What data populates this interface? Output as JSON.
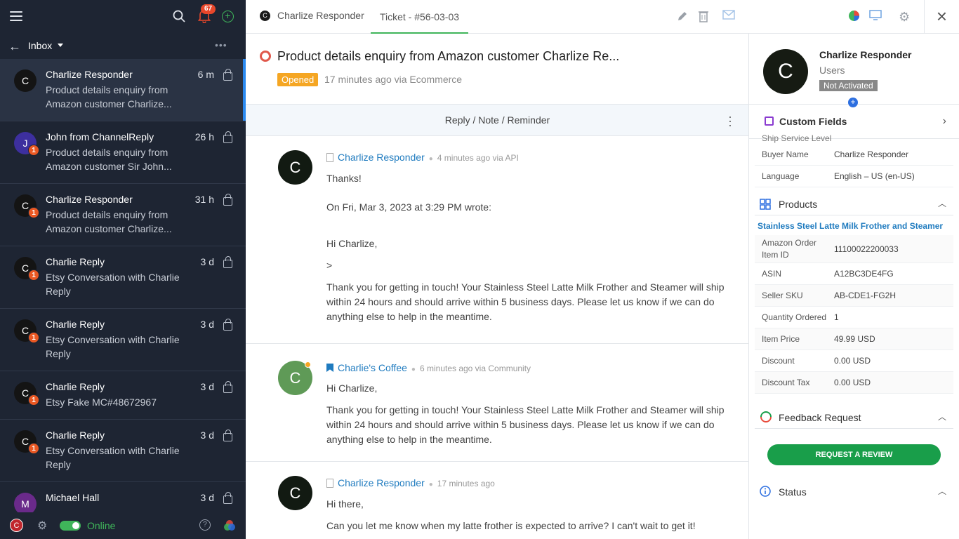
{
  "sidebar": {
    "notification_count": "67",
    "inbox_label": "Inbox",
    "conversations": [
      {
        "initial": "C",
        "name": "Charlize Responder",
        "time": "6 m",
        "preview": "Product details enquiry from Amazon customer Charlize...",
        "unread": ""
      },
      {
        "initial": "J",
        "name": "John from ChannelReply",
        "time": "26 h",
        "preview": "Product details enquiry from Amazon customer Sir John...",
        "unread": "1"
      },
      {
        "initial": "C",
        "name": "Charlize Responder",
        "time": "31 h",
        "preview": "Product details enquiry from Amazon customer Charlize...",
        "unread": "1"
      },
      {
        "initial": "C",
        "name": "Charlie Reply",
        "time": "3 d",
        "preview": "Etsy Conversation with Charlie Reply",
        "unread": "1"
      },
      {
        "initial": "C",
        "name": "Charlie Reply",
        "time": "3 d",
        "preview": "Etsy Conversation with Charlie Reply",
        "unread": "1"
      },
      {
        "initial": "C",
        "name": "Charlie Reply",
        "time": "3 d",
        "preview": "Etsy Fake MC#48672967",
        "unread": "1"
      },
      {
        "initial": "C",
        "name": "Charlie Reply",
        "time": "3 d",
        "preview": "Etsy Conversation with Charlie Reply",
        "unread": "1"
      },
      {
        "initial": "M",
        "name": "Michael Hall",
        "time": "3 d",
        "preview": "",
        "unread": ""
      }
    ],
    "user_initial": "C",
    "online_label": "Online"
  },
  "topbar": {
    "tab_contact_initial": "C",
    "tab_contact": "Charlize Responder",
    "tab_ticket": "Ticket - #56-03-03"
  },
  "ticket": {
    "title": "Product details enquiry from Amazon customer Charlize Re...",
    "status": "Opened",
    "meta": "17 minutes ago via Ecommerce",
    "reply_bar": "Reply / Note / Reminder",
    "messages": [
      {
        "initial": "C",
        "author": "Charlize Responder",
        "meta": "4 minutes ago via API",
        "lines": [
          "Thanks!",
          "On Fri, Mar 3, 2023 at 3:29 PM wrote:",
          "Hi Charlize,",
          ">",
          "Thank you for getting in touch! Your Stainless Steel Latte Milk Frother and Steamer will ship within 24 hours and should arrive within 5 business days. Please let us know if we can do anything else to help in the meantime."
        ]
      },
      {
        "initial": "C",
        "author": "Charlie's Coffee",
        "meta": "6 minutes ago via Community",
        "lines": [
          "Hi Charlize,",
          "Thank you for getting in touch! Your Stainless Steel Latte Milk Frother and Steamer will ship within 24 hours and should arrive within 5 business days. Please let us know if we can do anything else to help in the meantime."
        ]
      },
      {
        "initial": "C",
        "author": "Charlize Responder",
        "meta": "17 minutes ago",
        "lines": [
          "Hi there,",
          "Can you let me know when my latte frother is expected to arrive? I can't wait to get it!"
        ]
      }
    ]
  },
  "contact": {
    "initial": "C",
    "name": "Charlize Responder",
    "role": "Users",
    "status": "Not Activated",
    "custom_fields_label": "Custom Fields",
    "truncated_label": "Ship Service Level",
    "fields": [
      {
        "k": "Buyer Name",
        "v": "Charlize Responder"
      },
      {
        "k": "Language",
        "v": "English – US (en-US)"
      }
    ],
    "products_label": "Products",
    "product_link": "Stainless Steel Latte Milk Frother and Steamer",
    "product_fields": [
      {
        "k": "Amazon Order Item ID",
        "v": "11100022200033"
      },
      {
        "k": "ASIN",
        "v": "A12BC3DE4FG"
      },
      {
        "k": "Seller SKU",
        "v": "AB-CDE1-FG2H"
      },
      {
        "k": "Quantity Ordered",
        "v": "1"
      },
      {
        "k": "Item Price",
        "v": "49.99 USD"
      },
      {
        "k": "Discount",
        "v": "0.00 USD"
      },
      {
        "k": "Discount Tax",
        "v": "0.00 USD"
      }
    ],
    "feedback_label": "Feedback Request",
    "review_button": "REQUEST A REVIEW",
    "status_label": "Status"
  },
  "colors": {
    "sidebar_bg": "#1e2533",
    "accent_green": "#3fb55a",
    "opened": "#f5a623",
    "link": "#1f7bbf",
    "review_btn": "#199e4a"
  }
}
